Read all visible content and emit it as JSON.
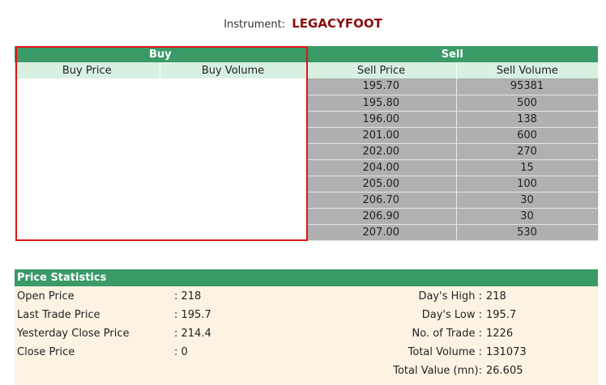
{
  "instrument": {
    "label": "Instrument:",
    "name": "LEGACYFOOT"
  },
  "depth": {
    "buy_header": "Buy",
    "sell_header": "Sell",
    "buy_price_header": "Buy Price",
    "buy_volume_header": "Buy Volume",
    "sell_price_header": "Sell Price",
    "sell_volume_header": "Sell Volume",
    "sell_rows": [
      {
        "price": "195.70",
        "volume": "95381"
      },
      {
        "price": "195.80",
        "volume": "500"
      },
      {
        "price": "196.00",
        "volume": "138"
      },
      {
        "price": "201.00",
        "volume": "600"
      },
      {
        "price": "202.00",
        "volume": "270"
      },
      {
        "price": "204.00",
        "volume": "15"
      },
      {
        "price": "205.00",
        "volume": "100"
      },
      {
        "price": "206.70",
        "volume": "30"
      },
      {
        "price": "206.90",
        "volume": "30"
      },
      {
        "price": "207.00",
        "volume": "530"
      }
    ]
  },
  "stats": {
    "title": "Price Statistics",
    "left": [
      {
        "label": "Open Price",
        "value": ": 218"
      },
      {
        "label": "Last Trade Price",
        "value": ": 195.7"
      },
      {
        "label": "Yesterday Close Price",
        "value": ": 214.4"
      },
      {
        "label": "Close Price",
        "value": ": 0"
      }
    ],
    "right": [
      {
        "label": "Day's High :",
        "value": "218"
      },
      {
        "label": "Day's Low :",
        "value": "195.7"
      },
      {
        "label": "No. of Trade :",
        "value": "1226"
      },
      {
        "label": "Total Volume :",
        "value": "131073"
      },
      {
        "label": "Total Value (mn):",
        "value": "26.605"
      }
    ]
  },
  "colors": {
    "header_green": "#3a9a68",
    "subheader_mint": "#d8f0e0",
    "sell_row_gray": "#b0b0b0",
    "instrument_red": "#8b0d0d",
    "highlight_red": "#e01515",
    "stats_bg": "#fdf3e3"
  }
}
